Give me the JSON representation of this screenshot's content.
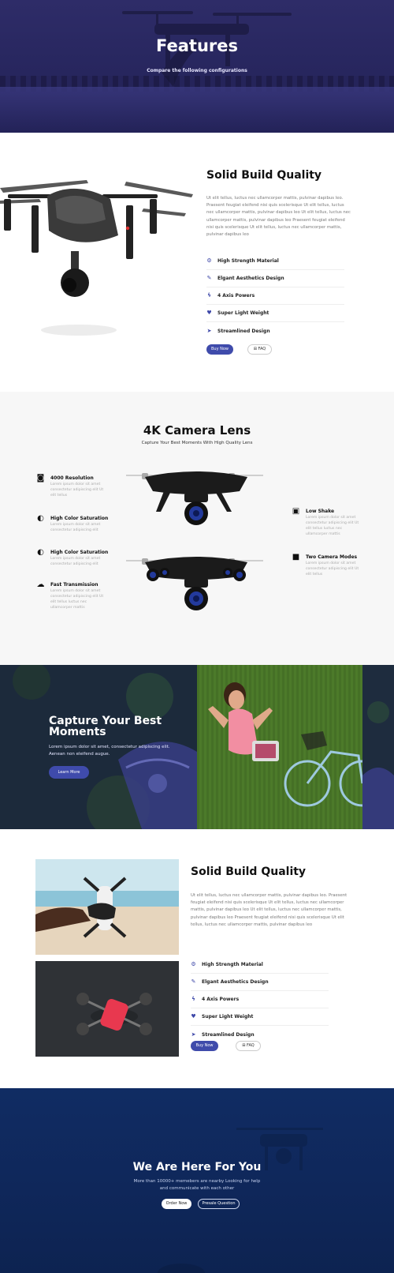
{
  "hero": {
    "title": "Features",
    "subtitle": "Compare the following configurations"
  },
  "build_section": {
    "title": "Solid Build Quality",
    "paragraph": "Ut elit tellus, luctus nec ullamcorper mattis, pulvinar dapibus leo. Praesent feugiat eleifend nisi quis scelerisque Ut elit tellus, luctus nec ullamcorper mattis, pulvinar dapibus leo Ut elit tellus, luctus nec ullamcorper mattis, pulvinar dapibus leo Praesent feugiat eleifend nisi quis scelerisque Ut elit tellus, luctus nec ullamcorper mattis, pulvinar dapibus leo",
    "features": [
      {
        "label": "High Strength Material",
        "icon": "gears-icon"
      },
      {
        "label": "Elgant Aesthetics Design",
        "icon": "brush-icon"
      },
      {
        "label": "4 Axis Powers",
        "icon": "bolt-icon"
      },
      {
        "label": "Super Light Weight",
        "icon": "heart-icon"
      },
      {
        "label": "Streamlined Design",
        "icon": "paper-plane-icon"
      }
    ],
    "buy_label": "Buy Now",
    "faq_label": "FAQ"
  },
  "camera_section": {
    "title": "4K Camera Lens",
    "subtitle": "Capture Your Best Moments With High Quality Lens",
    "left_features": [
      {
        "heading": "4000 Resolution",
        "desc": "Lorem ipsum dolor sit amet consectetur adipiscing elit Ut elit tellus",
        "icon": "camera-icon"
      },
      {
        "heading": "High Color Saturation",
        "desc": "Lorem ipsum dolor sit amet consectetur adipiscing elit",
        "icon": "contrast-icon"
      },
      {
        "heading": "High Color Saturation",
        "desc": "Lorem ipsum dolor sit amet consectetur adipiscing elit",
        "icon": "contrast-icon"
      },
      {
        "heading": "Fast Transmission",
        "desc": "Lorem ipsum dolor sit amet consectetur adipiscing elit Ut elit tellus luctus nec ullamcorper mattis",
        "icon": "cloud-icon"
      }
    ],
    "right_features": [
      {
        "heading": "Low Shake",
        "desc": "Lorem ipsum dolor sit amet consectetur adipiscing elit Ut elit tellus luctus nec ullamcorper mattis",
        "icon": "image-icon"
      },
      {
        "heading": "Two Camera Modes",
        "desc": "Lorem ipsum dolor sit amet consectetur adipiscing elit Ut elit tellus",
        "icon": "video-camera-icon"
      }
    ]
  },
  "moments_section": {
    "title": "Capture Your Best Moments",
    "paragraph": "Lorem ipsum dolor sit amet, consectetur adipiscing elit. Aenean non eleifend augue.",
    "button_label": "Learn More"
  },
  "build_section_2": {
    "title": "Solid Build Quality",
    "paragraph": "Ut elit tellus, luctus nec ullamcorper mattis, pulvinar dapibus leo. Praesent feugiat eleifend nisi quis scelerisque Ut elit tellus, luctus nec ullamcorper mattis, pulvinar dapibus leo Ut elit tellus, luctus nec ullamcorper mattis, pulvinar dapibus leo Praesent feugiat eleifend nisi quis scelerisque Ut elit tellus, luctus nec ullamcorper mattis, pulvinar dapibus leo",
    "features": [
      {
        "label": "High Strength Material",
        "icon": "gears-icon"
      },
      {
        "label": "Elgant Aesthetics Design",
        "icon": "brush-icon"
      },
      {
        "label": "4 Axis Powers",
        "icon": "bolt-icon"
      },
      {
        "label": "Super Light Weight",
        "icon": "heart-icon"
      },
      {
        "label": "Streamlined Design",
        "icon": "paper-plane-icon"
      }
    ],
    "buy_label": "Buy Now",
    "faq_label": "FAQ"
  },
  "cta_section": {
    "title": "We Are Here For You",
    "subtitle": "More than 10000+ memebers are nearby Looking for help and communicate with each other",
    "order_label": "Order Now",
    "question_label": "Presale Question"
  },
  "colors": {
    "accent": "#3f4bab",
    "hero_bg": "#2a285f",
    "cta_bg": "#0f275a"
  }
}
